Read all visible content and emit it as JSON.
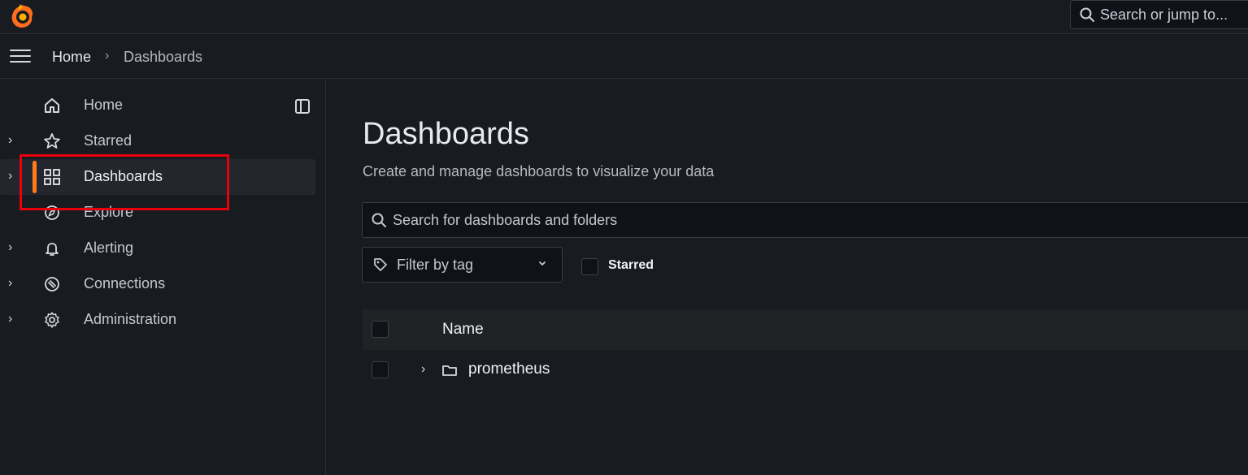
{
  "app": {
    "logo_icon": "grafana-logo-icon",
    "accent_color": "#ff7a1a",
    "highlight_color": "#e8000b"
  },
  "topbar": {
    "search_text": "Search or jump to..."
  },
  "breadcrumb": {
    "home": "Home",
    "separator": "›",
    "current": "Dashboards"
  },
  "sidebar": {
    "items": [
      {
        "label": "Home",
        "icon": "home-icon",
        "expandable": false
      },
      {
        "label": "Starred",
        "icon": "star-icon",
        "expandable": true
      },
      {
        "label": "Dashboards",
        "icon": "dashboards-grid-icon",
        "expandable": true,
        "active": true
      },
      {
        "label": "Explore",
        "icon": "compass-icon",
        "expandable": false
      },
      {
        "label": "Alerting",
        "icon": "bell-icon",
        "expandable": true
      },
      {
        "label": "Connections",
        "icon": "connections-icon",
        "expandable": true
      },
      {
        "label": "Administration",
        "icon": "gear-icon",
        "expandable": true
      }
    ]
  },
  "main": {
    "title": "Dashboards",
    "subtitle": "Create and manage dashboards to visualize your data",
    "search_placeholder": "Search for dashboards and folders",
    "tag_filter_label": "Filter by tag",
    "starred_label": "Starred",
    "table": {
      "header_name": "Name",
      "rows": [
        {
          "type": "folder",
          "name": "prometheus"
        }
      ]
    }
  }
}
